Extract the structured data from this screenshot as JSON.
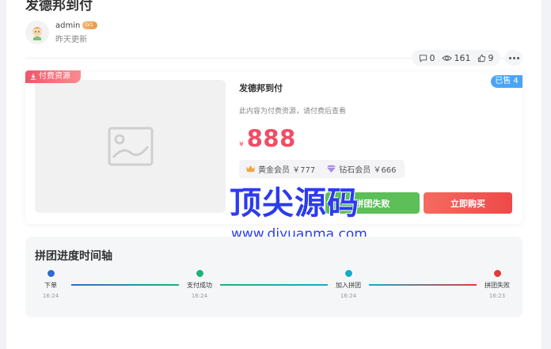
{
  "post": {
    "title": "发德邦到付",
    "author": "admin",
    "level": "LV1",
    "updated": "昨天更新"
  },
  "stats": {
    "comments": "0",
    "views": "161",
    "likes": "9"
  },
  "resource": {
    "paid_tag": "付费资源",
    "sold_tag": "已售 4",
    "name": "发德邦到付",
    "desc": "此内容为付费资源，请付费后查看",
    "price_symbol": "¥",
    "price": "888",
    "vip_gold": "黄金会员 ￥777",
    "vip_diamond": "钻石会员 ￥666",
    "group_fail_btn": "拼团失败",
    "buy_btn": "立即购买"
  },
  "watermark": {
    "cn": "顶尖源码",
    "url": "www.djyuanma.com"
  },
  "timeline": {
    "title": "拼团进度时间轴",
    "steps": [
      {
        "label": "下单",
        "time": "16:24",
        "color": "#2f6bd6"
      },
      {
        "label": "支付成功",
        "time": "16:24",
        "color": "#1db37a"
      },
      {
        "label": "加入拼团",
        "time": "16:24",
        "color": "#16aacb"
      },
      {
        "label": "拼团失败",
        "time": "16:23",
        "color": "#e53b3b"
      }
    ]
  },
  "colors": {
    "price": "#f24c65",
    "button_green": "#5cbf58",
    "button_red": "#ee4a4a",
    "sold_tag": "#4aa5f6"
  }
}
